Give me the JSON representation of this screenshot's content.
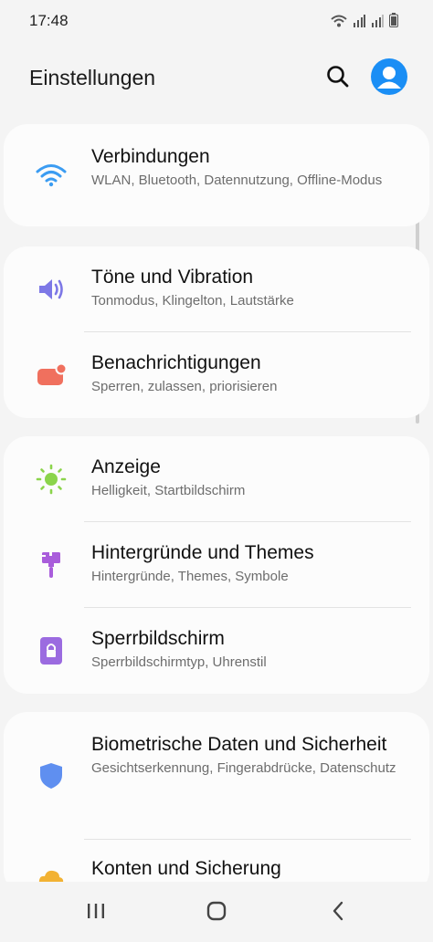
{
  "status_bar": {
    "time": "17:48",
    "icons": [
      "wifi-icon",
      "signal-icon",
      "signal-icon",
      "battery-icon"
    ]
  },
  "header": {
    "title": "Einstellungen",
    "search_icon": "search-icon",
    "avatar_icon": "account-icon",
    "accent": "#1a8ef5"
  },
  "groups": [
    {
      "items": [
        {
          "title": "Verbindungen",
          "subtitle": "WLAN, Bluetooth, Datennutzung, Offline-Modus",
          "icon": "wifi-icon",
          "color": "#3b9cf2"
        }
      ]
    },
    {
      "items": [
        {
          "title": "Töne und Vibration",
          "subtitle": "Tonmodus, Klingelton, Lautstärke",
          "icon": "speaker-icon",
          "color": "#7d78e6"
        },
        {
          "title": "Benachrichtigungen",
          "subtitle": "Sperren, zulassen, priorisieren",
          "icon": "notification-icon",
          "color": "#f0705e"
        }
      ]
    },
    {
      "items": [
        {
          "title": "Anzeige",
          "subtitle": "Helligkeit, Startbildschirm",
          "icon": "brightness-icon",
          "color": "#8bd44b"
        },
        {
          "title": "Hintergründe und Themes",
          "subtitle": "Hintergründe, Themes, Symbole",
          "icon": "paintbrush-icon",
          "color": "#a95ddb"
        },
        {
          "title": "Sperrbildschirm",
          "subtitle": "Sperrbildschirmtyp, Uhrenstil",
          "icon": "lock-screen-icon",
          "color": "#9b6be0"
        }
      ]
    },
    {
      "items": [
        {
          "title": "Biometrische Daten und Sicherheit",
          "subtitle": "Gesichtserkennung, Fingerabdrücke, Datenschutz",
          "icon": "shield-icon",
          "color": "#5f8ff0"
        },
        {
          "title": "Konten und Sicherung",
          "subtitle": "",
          "icon": "cloud-icon",
          "color": "#f2b233"
        }
      ]
    }
  ],
  "nav_bar": {
    "recents_icon": "recents-icon",
    "home_icon": "home-icon",
    "back_icon": "back-icon"
  }
}
